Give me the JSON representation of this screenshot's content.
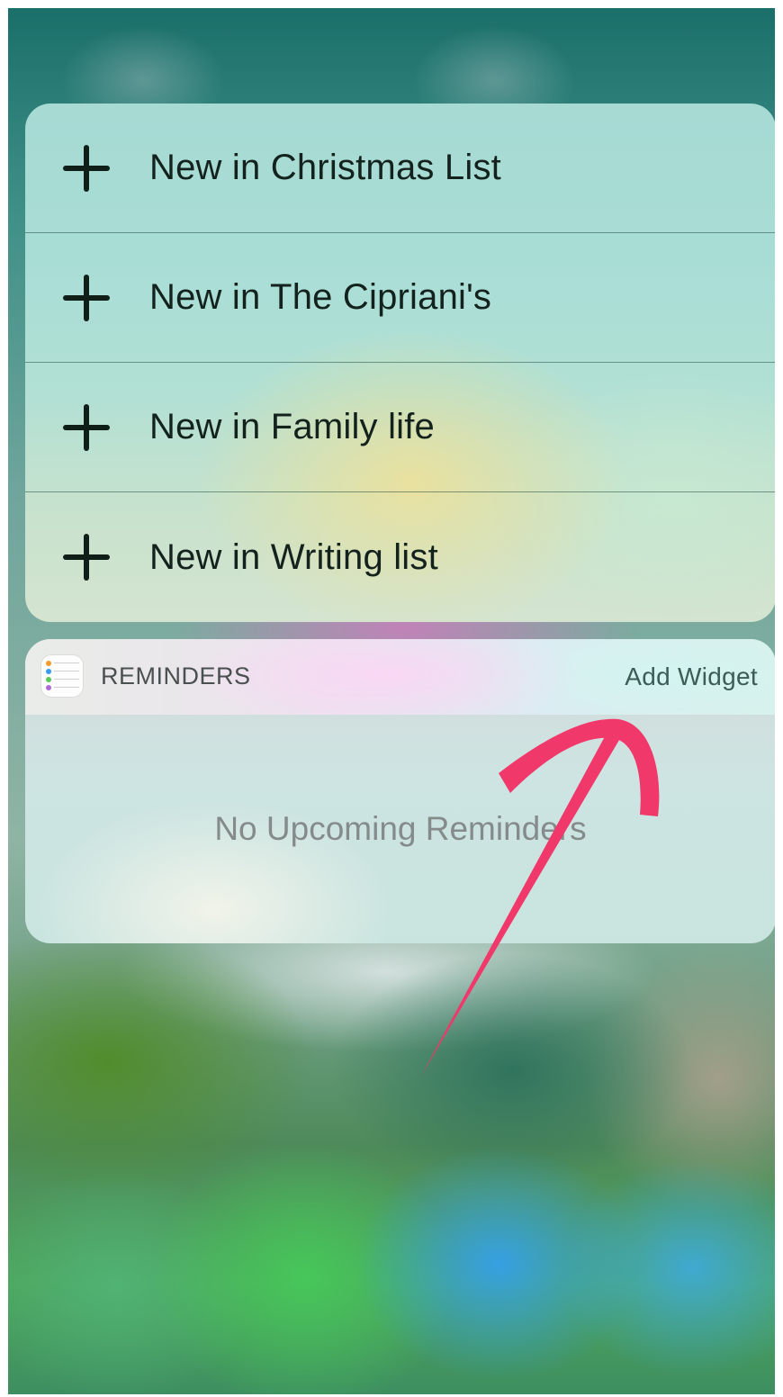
{
  "quick_actions": [
    {
      "icon": "plus-icon",
      "label": "New in Christmas List"
    },
    {
      "icon": "plus-icon",
      "label": "New in The Cipriani's"
    },
    {
      "icon": "plus-icon",
      "label": "New in Family life"
    },
    {
      "icon": "plus-icon",
      "label": "New in Writing list"
    }
  ],
  "widget": {
    "app_icon": "reminders-app-icon",
    "title": "REMINDERS",
    "add_widget_label": "Add Widget",
    "empty_message": "No Upcoming Reminders"
  },
  "annotation": {
    "type": "arrow",
    "color": "#f0386b",
    "points_to": "Add Widget"
  }
}
